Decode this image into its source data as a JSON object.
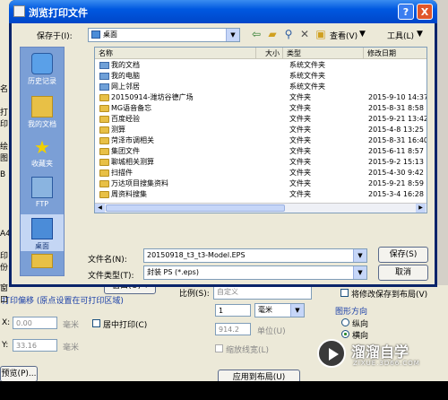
{
  "dialog": {
    "title": "浏览打印文件",
    "help_label": "?",
    "close_label": "X",
    "save_in_label": "保存于(I):",
    "save_in_value": "桌面",
    "view_label": "查看(V)",
    "tools_label": "工具(L)",
    "columns": [
      "名称",
      "大小",
      "类型",
      "修改日期"
    ],
    "places": [
      "历史记录",
      "我的文档",
      "收藏夹",
      "FTP",
      "桌面"
    ],
    "files": [
      {
        "name": "我的文档",
        "type": "系统文件夹",
        "date": "",
        "icon": "system-folder"
      },
      {
        "name": "我的电脑",
        "type": "系统文件夹",
        "date": "",
        "icon": "computer"
      },
      {
        "name": "网上邻居",
        "type": "系统文件夹",
        "date": "",
        "icon": "network"
      },
      {
        "name": "20150914-潍坊谷德广场",
        "type": "文件夹",
        "date": "2015-9-10 14:37",
        "icon": "folder"
      },
      {
        "name": "MG语音备忘",
        "type": "文件夹",
        "date": "2015-8-31 8:58",
        "icon": "folder"
      },
      {
        "name": "百度经验",
        "type": "文件夹",
        "date": "2015-9-21 13:42",
        "icon": "folder"
      },
      {
        "name": "测算",
        "type": "文件夹",
        "date": "2015-4-8 13:25",
        "icon": "folder"
      },
      {
        "name": "菏泽市调相关",
        "type": "文件夹",
        "date": "2015-8-31 16:40",
        "icon": "folder"
      },
      {
        "name": "集团文件",
        "type": "文件夹",
        "date": "2015-6-11 8:57",
        "icon": "folder"
      },
      {
        "name": "聊城相关测算",
        "type": "文件夹",
        "date": "2015-9-2 15:13",
        "icon": "folder"
      },
      {
        "name": "扫描件",
        "type": "文件夹",
        "date": "2015-4-30 9:42",
        "icon": "folder"
      },
      {
        "name": "万达项目搜集资料",
        "type": "文件夹",
        "date": "2015-9-21 8:59",
        "icon": "folder"
      },
      {
        "name": "周资料搜集",
        "type": "文件夹",
        "date": "2015-3-4 16:28",
        "icon": "folder"
      }
    ],
    "filename_label": "文件名(N):",
    "filename_value": "20150918_t3_t3-Model.EPS",
    "filetype_label": "文件类型(T):",
    "filetype_value": "封装 PS (*.eps)",
    "save_button": "保存(S)",
    "cancel_button": "取消"
  },
  "background": {
    "left_labels": [
      "名",
      "打印",
      "绘图",
      "B",
      "A4",
      "印份",
      "窗口"
    ],
    "offset_group": "打印偏移 (原点设置在可打印区域)",
    "x_label": "X:",
    "x_value": "0.00",
    "y_label": "Y:",
    "y_value": "33.16",
    "unit_mm": "毫米",
    "center_print": "居中打印(C)",
    "scale_label": "比例(S):",
    "scale_value": "自定义",
    "scale_num": "1",
    "scale_unit": "毫米",
    "scale_units_value": "914.2",
    "units_label": "单位(U)",
    "lineweight_label": "缩放线宽(L)",
    "save_layout_label": "将修改保存到布局(V)",
    "orientation_group": "图形方向",
    "portrait": "纵向",
    "landscape": "横向",
    "apply_layout_button": "应用到布局(U)",
    "window_button": "窗口(O)<",
    "preview_button": "预览(P)..."
  },
  "watermark": {
    "brand": "溜溜自学",
    "url": "ZIXUE.3D66.COM"
  }
}
